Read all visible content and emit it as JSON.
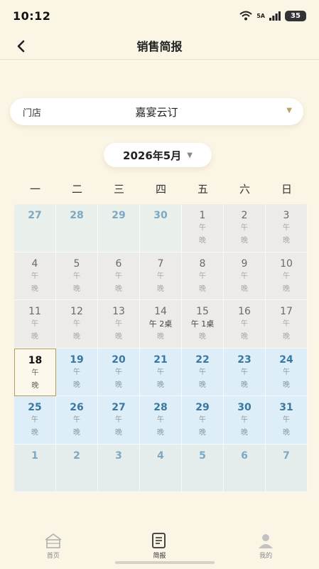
{
  "status_bar": {
    "time": "10:12",
    "network": "5A",
    "battery": "35"
  },
  "header": {
    "title": "销售简报"
  },
  "store_filter": {
    "label": "门店",
    "value": "嘉宴云订"
  },
  "month_picker": {
    "label": "2026年5月"
  },
  "calendar": {
    "weekdays": [
      "一",
      "二",
      "三",
      "四",
      "五",
      "六",
      "日"
    ],
    "lunch_label": "午",
    "dinner_label": "晚",
    "days": [
      {
        "day": "27",
        "type": "prev"
      },
      {
        "day": "28",
        "type": "prev"
      },
      {
        "day": "29",
        "type": "prev"
      },
      {
        "day": "30",
        "type": "prev"
      },
      {
        "day": "1",
        "type": "past",
        "slots": [
          "午",
          "晚"
        ]
      },
      {
        "day": "2",
        "type": "past",
        "slots": [
          "午",
          "晚"
        ]
      },
      {
        "day": "3",
        "type": "past",
        "slots": [
          "午",
          "晚"
        ]
      },
      {
        "day": "4",
        "type": "past",
        "slots": [
          "午",
          "晚"
        ]
      },
      {
        "day": "5",
        "type": "past",
        "slots": [
          "午",
          "晚"
        ]
      },
      {
        "day": "6",
        "type": "past",
        "slots": [
          "午",
          "晚"
        ]
      },
      {
        "day": "7",
        "type": "past",
        "slots": [
          "午",
          "晚"
        ]
      },
      {
        "day": "8",
        "type": "past",
        "slots": [
          "午",
          "晚"
        ]
      },
      {
        "day": "9",
        "type": "past",
        "slots": [
          "午",
          "晚"
        ]
      },
      {
        "day": "10",
        "type": "past",
        "slots": [
          "午",
          "晚"
        ]
      },
      {
        "day": "11",
        "type": "past",
        "slots": [
          "午",
          "晚"
        ]
      },
      {
        "day": "12",
        "type": "past",
        "slots": [
          "午",
          "晚"
        ]
      },
      {
        "day": "13",
        "type": "past",
        "slots": [
          "午",
          "晚"
        ]
      },
      {
        "day": "14",
        "type": "past",
        "slots": [
          "午 2桌",
          "晚"
        ],
        "booked": [
          true,
          false
        ]
      },
      {
        "day": "15",
        "type": "past",
        "slots": [
          "午 1桌",
          "晚"
        ],
        "booked": [
          true,
          false
        ]
      },
      {
        "day": "16",
        "type": "past",
        "slots": [
          "午",
          "晚"
        ]
      },
      {
        "day": "17",
        "type": "past",
        "slots": [
          "午",
          "晚"
        ]
      },
      {
        "day": "18",
        "type": "today",
        "slots": [
          "午",
          "晚"
        ]
      },
      {
        "day": "19",
        "type": "future",
        "slots": [
          "午",
          "晚"
        ]
      },
      {
        "day": "20",
        "type": "future",
        "slots": [
          "午",
          "晚"
        ]
      },
      {
        "day": "21",
        "type": "future",
        "slots": [
          "午",
          "晚"
        ]
      },
      {
        "day": "22",
        "type": "future",
        "slots": [
          "午",
          "晚"
        ]
      },
      {
        "day": "23",
        "type": "future",
        "slots": [
          "午",
          "晚"
        ]
      },
      {
        "day": "24",
        "type": "future",
        "slots": [
          "午",
          "晚"
        ]
      },
      {
        "day": "25",
        "type": "future",
        "slots": [
          "午",
          "晚"
        ]
      },
      {
        "day": "26",
        "type": "future",
        "slots": [
          "午",
          "晚"
        ]
      },
      {
        "day": "27",
        "type": "future",
        "slots": [
          "午",
          "晚"
        ]
      },
      {
        "day": "28",
        "type": "future",
        "slots": [
          "午",
          "晚"
        ]
      },
      {
        "day": "29",
        "type": "future",
        "slots": [
          "午",
          "晚"
        ]
      },
      {
        "day": "30",
        "type": "future",
        "slots": [
          "午",
          "晚"
        ]
      },
      {
        "day": "31",
        "type": "future",
        "slots": [
          "午",
          "晚"
        ]
      },
      {
        "day": "1",
        "type": "next"
      },
      {
        "day": "2",
        "type": "next"
      },
      {
        "day": "3",
        "type": "next"
      },
      {
        "day": "4",
        "type": "next"
      },
      {
        "day": "5",
        "type": "next"
      },
      {
        "day": "6",
        "type": "next"
      },
      {
        "day": "7",
        "type": "next"
      }
    ]
  },
  "tabbar": {
    "items": [
      {
        "label": "首页",
        "icon": "home-icon",
        "active": false
      },
      {
        "label": "简报",
        "icon": "report-icon",
        "active": true
      },
      {
        "label": "我的",
        "icon": "user-icon",
        "active": false
      }
    ]
  },
  "colors": {
    "background": "#fbf5e6",
    "accent_gold": "#b79a55",
    "future_cell": "#deeef9",
    "future_text": "#3a78a1"
  }
}
